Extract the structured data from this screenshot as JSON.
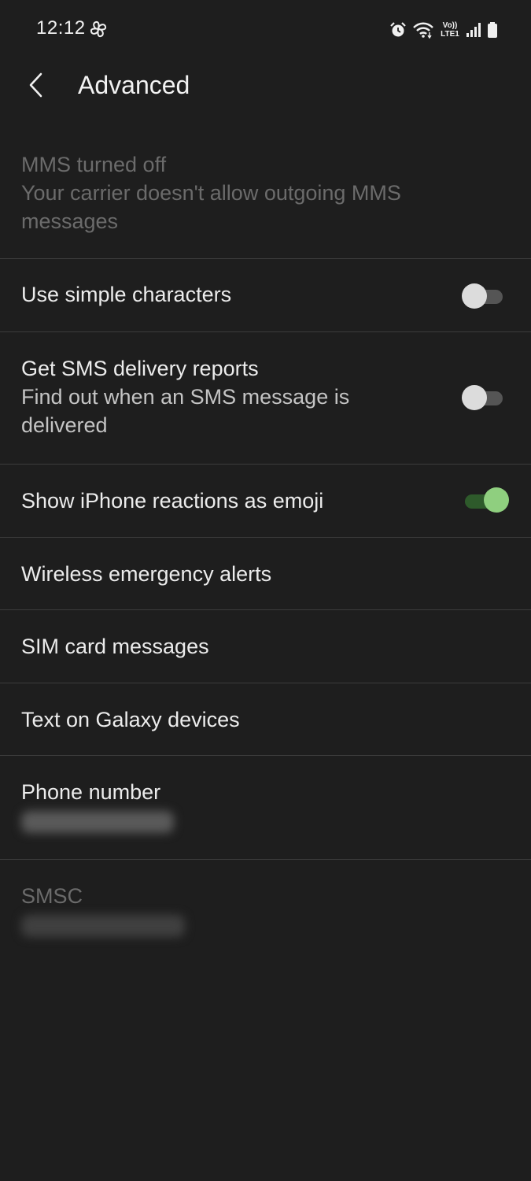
{
  "status_bar": {
    "time": "12:12",
    "volte_top": "Vo))",
    "volte_bottom": "LTE1"
  },
  "header": {
    "title": "Advanced"
  },
  "settings": {
    "mms": {
      "title": "MMS turned off",
      "subtitle": "Your carrier doesn't allow outgoing MMS messages"
    },
    "simple_characters": {
      "title": "Use simple characters",
      "enabled": false
    },
    "sms_delivery": {
      "title": "Get SMS delivery reports",
      "subtitle": "Find out when an SMS message is delivered",
      "enabled": false
    },
    "iphone_reactions": {
      "title": "Show iPhone reactions as emoji",
      "enabled": true
    },
    "wireless_alerts": {
      "title": "Wireless emergency alerts"
    },
    "sim_messages": {
      "title": "SIM card messages"
    },
    "text_galaxy": {
      "title": "Text on Galaxy devices"
    },
    "phone_number": {
      "title": "Phone number"
    },
    "smsc": {
      "title": "SMSC"
    }
  },
  "colors": {
    "background": "#1e1e1e",
    "toggle_on": "#8fcf7f",
    "divider": "#3c3c3c"
  }
}
